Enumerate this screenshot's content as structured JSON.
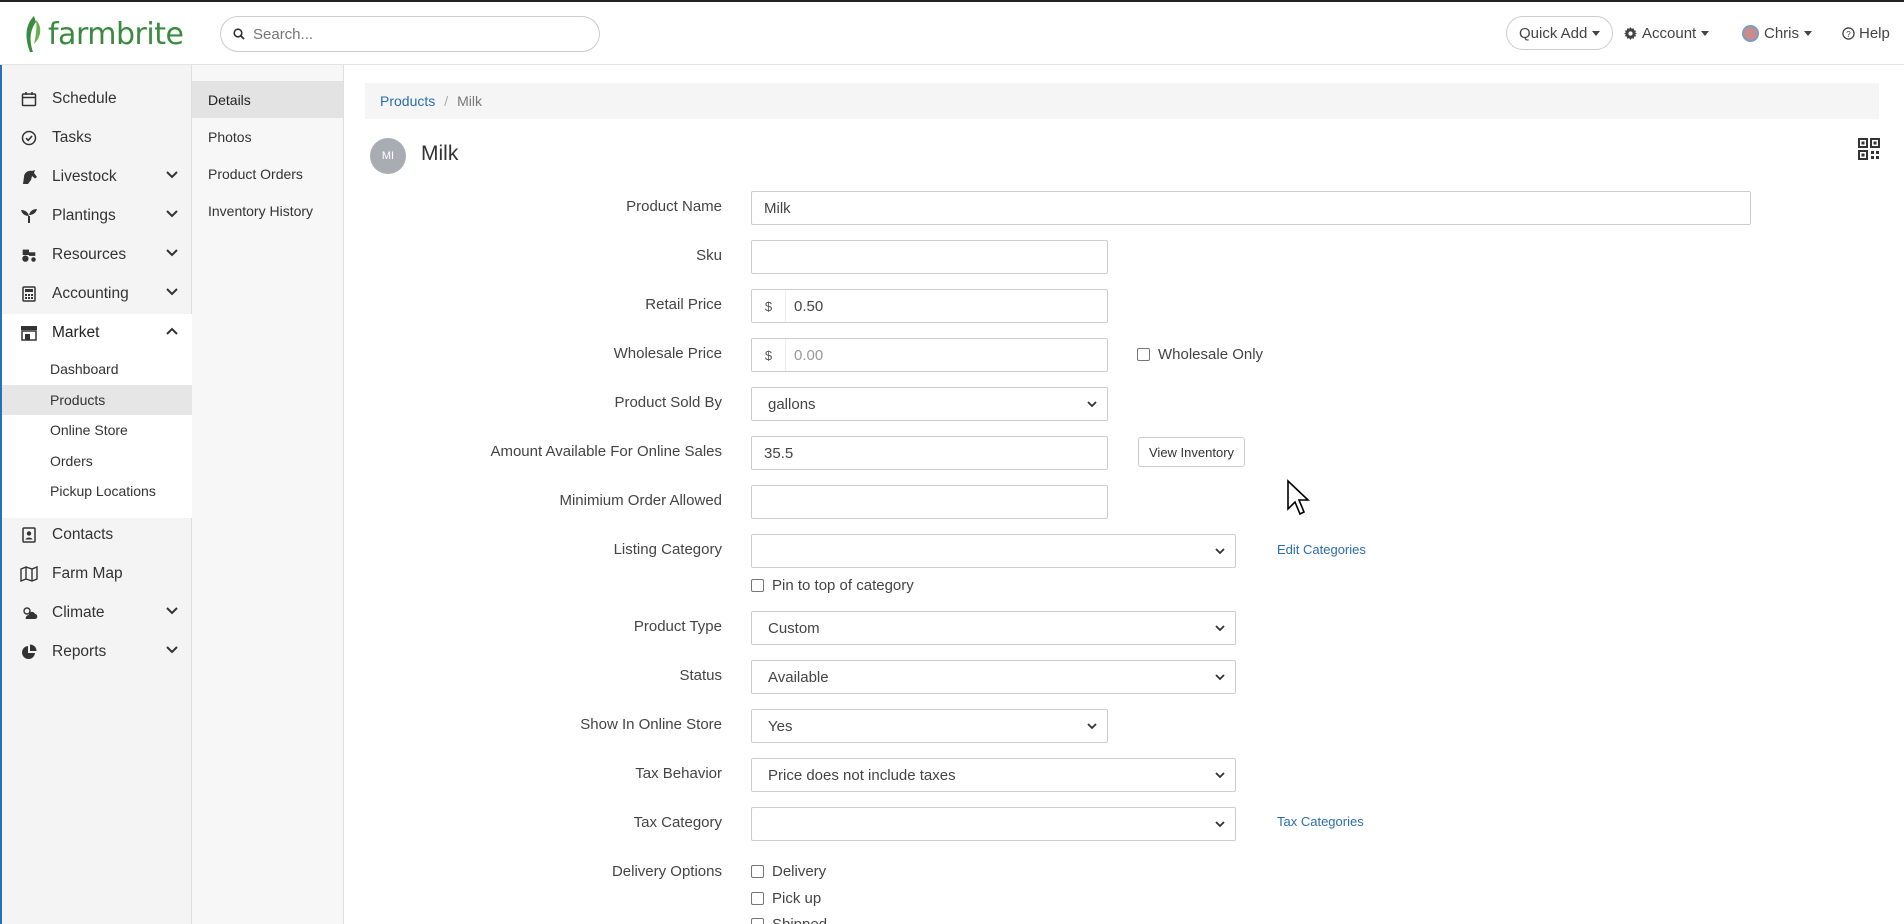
{
  "header": {
    "logo_text": "farmbrite",
    "search_placeholder": "Search...",
    "quick_add": "Quick Add",
    "account": "Account",
    "user": "Chris",
    "help": "Help"
  },
  "sidebar": {
    "items": [
      {
        "label": "Schedule",
        "icon": "calendar-icon"
      },
      {
        "label": "Tasks",
        "icon": "check-circle-icon"
      },
      {
        "label": "Livestock",
        "icon": "horse-icon"
      },
      {
        "label": "Plantings",
        "icon": "seedling-icon"
      },
      {
        "label": "Resources",
        "icon": "tractor-icon"
      },
      {
        "label": "Accounting",
        "icon": "calculator-icon"
      },
      {
        "label": "Market",
        "icon": "store-icon"
      },
      {
        "label": "Contacts",
        "icon": "contact-card-icon"
      },
      {
        "label": "Farm Map",
        "icon": "map-icon"
      },
      {
        "label": "Climate",
        "icon": "cloud-sun-icon"
      },
      {
        "label": "Reports",
        "icon": "pie-chart-icon"
      }
    ],
    "market_sub": [
      "Dashboard",
      "Products",
      "Online Store",
      "Orders",
      "Pickup Locations"
    ]
  },
  "subnav": [
    "Details",
    "Photos",
    "Product Orders",
    "Inventory History"
  ],
  "breadcrumb": {
    "parent": "Products",
    "current": "Milk"
  },
  "product": {
    "initials": "MI",
    "title": "Milk"
  },
  "form": {
    "product_name_label": "Product Name",
    "product_name": "Milk",
    "sku_label": "Sku",
    "sku": "",
    "retail_price_label": "Retail Price",
    "currency": "$",
    "retail_price": "0.50",
    "wholesale_price_label": "Wholesale Price",
    "wholesale_price_placeholder": "0.00",
    "wholesale_only": "Wholesale Only",
    "sold_by_label": "Product Sold By",
    "sold_by": "gallons",
    "amount_label": "Amount Available For Online Sales",
    "amount": "35.5",
    "view_inventory": "View Inventory",
    "min_order_label": "Minimium Order Allowed",
    "min_order": "",
    "listing_category_label": "Listing Category",
    "listing_category": "",
    "edit_categories": "Edit Categories",
    "pin_to_top": "Pin to top of category",
    "product_type_label": "Product Type",
    "product_type": "Custom",
    "status_label": "Status",
    "status": "Available",
    "show_online_label": "Show In Online Store",
    "show_online": "Yes",
    "tax_behavior_label": "Tax Behavior",
    "tax_behavior": "Price does not include taxes",
    "tax_category_label": "Tax Category",
    "tax_category": "",
    "tax_categories": "Tax Categories",
    "delivery_label": "Delivery Options",
    "delivery": "Delivery",
    "pickup": "Pick up",
    "shipped": "Shipped"
  }
}
